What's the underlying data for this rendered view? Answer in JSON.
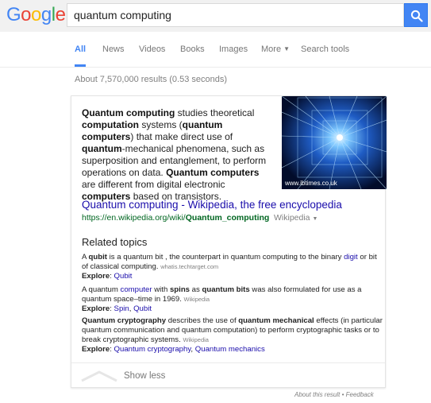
{
  "header": {
    "logo": "Google",
    "query": "quantum computing",
    "colors": {
      "blue": "#4285f4",
      "red": "#ea4335",
      "yellow": "#fbbc05",
      "green": "#34a853"
    }
  },
  "tabs": [
    {
      "label": "All",
      "active": true
    },
    {
      "label": "News"
    },
    {
      "label": "Videos"
    },
    {
      "label": "Books"
    },
    {
      "label": "Images"
    },
    {
      "label": "More"
    },
    {
      "label": "Search tools"
    }
  ],
  "stats": "About 7,570,000 results (0.53 seconds)",
  "knowledge_panel": {
    "description": {
      "p1_b": "Quantum computing",
      "p1": " studies theoretical ",
      "p2_b": "computation",
      "p2": " systems (",
      "p3_b": "quantum computers",
      "p3": ") that make direct use of ",
      "p4_b": "quantum",
      "p4": "-mechanical phenomena, such as superposition and entanglement, to perform operations on data. ",
      "p5_b": "Quantum computers",
      "p5": " are different from digital electronic ",
      "p6_b": "computers",
      "p6": " based on transistors."
    },
    "image_caption": "www.ibtimes.co.uk",
    "wiki_title": "Quantum computing - Wikipedia, the free encyclopedia",
    "wiki_url_prefix": "https://en.wikipedia.org/wiki/",
    "wiki_url_bold": "Quantum_computing",
    "wiki_source": "Wikipedia",
    "related_title": "Related topics",
    "topics": [
      {
        "t1": "A ",
        "t2_b": "qubit",
        "t3": " is a quantum bit , the counterpart in quantum computing to the binary ",
        "t4_link": "digit",
        "t5": " or bit of classical computing.",
        "source": "whatis.techtarget.com",
        "explore_label": "Explore",
        "explore_links": [
          "Qubit"
        ]
      },
      {
        "t1": "A quantum ",
        "t2_link": "computer",
        "t3": " with ",
        "t4_b": "spins",
        "t5": " as ",
        "t6_b": "quantum bits",
        "t7": " was also formulated for use as a quantum space–time in 1969.",
        "source": "Wikipedia",
        "explore_label": "Explore",
        "explore_links": [
          "Spin",
          "Qubit"
        ]
      },
      {
        "t1_b": "Quantum cryptography",
        "t2": " describes the use of ",
        "t3_b": "quantum mechanical",
        "t4": " effects (in particular quantum communication and quantum computation) to perform cryptographic tasks or to break cryptographic systems.",
        "source": "Wikipedia",
        "explore_label": "Explore",
        "explore_links": [
          "Quantum cryptography",
          "Quantum mechanics"
        ]
      }
    ],
    "show_less": "Show less"
  },
  "footer": {
    "about": "About this result",
    "sep": " • ",
    "feedback": "Feedback"
  }
}
